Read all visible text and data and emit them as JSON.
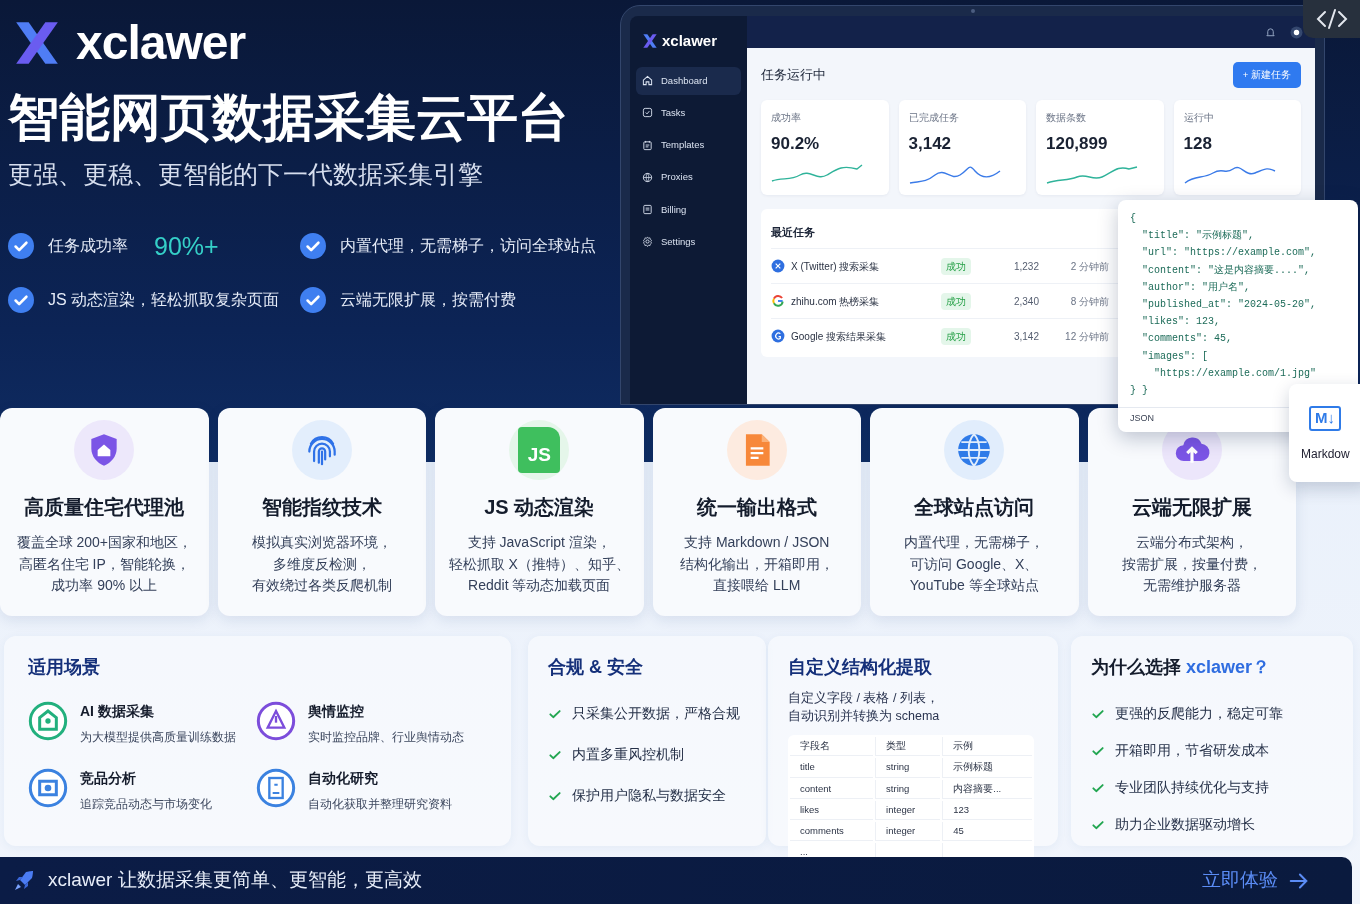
{
  "hero": {
    "brand": "xclawer",
    "title": "智能网页数据采集云平台",
    "subtitle": "更强、更稳、更智能的下一代数据采集引擎",
    "highlights": [
      {
        "label": "任务成功率",
        "highlight": "90%+"
      },
      {
        "label": "内置代理，无需梯子，访问全球站点"
      },
      {
        "label": "JS 动态渲染，轻松抓取复杂页面"
      },
      {
        "label": "云端无限扩展，按需付费"
      }
    ]
  },
  "dashboard": {
    "brand": "xclawer",
    "sidebar": {
      "items": [
        {
          "label": "Dashboard",
          "kind": "home",
          "selected": true
        },
        {
          "label": "Tasks",
          "kind": "tasks",
          "selected": false
        },
        {
          "label": "Templates",
          "kind": "templates",
          "selected": false
        },
        {
          "label": "Proxies",
          "kind": "globe",
          "selected": false
        },
        {
          "label": "Billing",
          "kind": "billing",
          "selected": false
        },
        {
          "label": "Settings",
          "kind": "gear",
          "selected": false
        }
      ]
    },
    "page_title": "任务运行中",
    "new_button": "+ 新建任务",
    "stats": [
      {
        "label": "成功率",
        "value": "90.2%",
        "color": "#2fb39a"
      },
      {
        "label": "已完成任务",
        "value": "3,142",
        "color": "#3b7be8"
      },
      {
        "label": "数据条数",
        "value": "120,899",
        "color": "#2fb39a"
      },
      {
        "label": "运行中",
        "value": "128",
        "color": "#3b7be8"
      }
    ],
    "recent": {
      "title": "最近任务",
      "rows": [
        {
          "kind": "x",
          "name": "X (Twitter) 搜索采集",
          "status": "成功",
          "count": "1,232",
          "time": "2 分钟前"
        },
        {
          "kind": "g",
          "name": "zhihu.com 热榜采集",
          "status": "成功",
          "count": "2,340",
          "time": "8 分钟前"
        },
        {
          "kind": "gblue",
          "name": "Google 搜索结果采集",
          "status": "成功",
          "count": "3,142",
          "time": "12 分钟前"
        }
      ]
    }
  },
  "json_preview": {
    "lines": [
      "{",
      "  \"title\": \"示例标题\",",
      "  \"url\": \"https://example.com\",",
      "  \"content\": \"这是内容摘要....\",",
      "  \"author\": \"用户名\",",
      "  \"published_at\": \"2024-05-20\",",
      "  \"likes\": 123,",
      "  \"comments\": 45,",
      "  \"images\": [",
      "    \"https://example.com/1.jpg\"",
      "} }"
    ],
    "label": "JSON"
  },
  "markdown_card": {
    "icon_text": "M↓",
    "label": "Markdow"
  },
  "features": [
    {
      "kind": "shield",
      "title": "高质量住宅代理池",
      "lines": [
        "覆盖全球 200+国家和地区，",
        "高匿名住宅 IP，智能轮换，",
        "成功率 90% 以上"
      ]
    },
    {
      "kind": "fingerprint",
      "title": "智能指纹技术",
      "lines": [
        "模拟真实浏览器环境，",
        "多维度反检测，",
        "有效绕过各类反爬机制"
      ]
    },
    {
      "kind": "js",
      "icon_text": "JS",
      "title": "JS 动态渲染",
      "lines": [
        "支持 JavaScript 渲染，",
        "轻松抓取 X（推特）、知乎、",
        "Reddit 等动态加载页面"
      ]
    },
    {
      "kind": "doc",
      "title": "统一输出格式",
      "lines": [
        "支持 Markdown / JSON",
        "结构化输出，开箱即用，",
        "直接喂给 LLM"
      ]
    },
    {
      "kind": "globe",
      "title": "全球站点访问",
      "lines": [
        "内置代理，无需梯子，",
        "可访问 Google、X、",
        "YouTube 等全球站点"
      ]
    },
    {
      "kind": "cloud",
      "title": "云端无限扩展",
      "lines": [
        "云端分布式架构，",
        "按需扩展，按量付费，",
        "无需维护服务器"
      ]
    }
  ],
  "scenarios": {
    "title": "适用场景",
    "items": [
      {
        "kind": "house",
        "color": "#22b07d",
        "title": "AI 数据采集",
        "desc": "为大模型提供高质量训练数据"
      },
      {
        "kind": "alert",
        "color": "#7c4ddb",
        "title": "舆情监控",
        "desc": "实时监控品牌、行业舆情动态"
      },
      {
        "kind": "target",
        "color": "#3b82e0",
        "title": "竞品分析",
        "desc": "追踪竞品动态与市场变化"
      },
      {
        "kind": "report",
        "color": "#3b82e0",
        "title": "自动化研究",
        "desc": "自动化获取并整理研究资料"
      }
    ]
  },
  "compliance": {
    "title": "合规 & 安全",
    "items": [
      "只采集公开数据，严格合规",
      "内置多重风控机制",
      "保护用户隐私与数据安全"
    ]
  },
  "extraction": {
    "title": "自定义结构化提取",
    "lines": [
      "自定义字段 / 表格 / 列表，",
      "自动识别并转换为 schema"
    ],
    "table": {
      "columns": [
        "字段名",
        "类型",
        "示例"
      ],
      "rows": [
        [
          "title",
          "string",
          "示例标题"
        ],
        [
          "content",
          "string",
          "内容摘要..."
        ],
        [
          "likes",
          "integer",
          "123"
        ],
        [
          "comments",
          "integer",
          "45"
        ],
        [
          "..."
        ]
      ]
    }
  },
  "why": {
    "title": "为什么选择",
    "brand": "xclawer？",
    "items": [
      "更强的反爬能力，稳定可靠",
      "开箱即用，节省研发成本",
      "专业团队持续优化与支持",
      "助力企业数据驱动增长"
    ]
  },
  "footer": {
    "slogan": "xclawer 让数据采集更简单、更智能，更高效",
    "cta": "立即体验"
  }
}
